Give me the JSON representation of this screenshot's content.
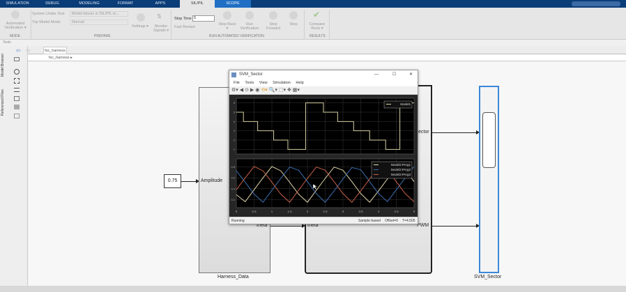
{
  "tabs": [
    "SIMULATION",
    "DEBUG",
    "MODELING",
    "FORMAT",
    "APPS",
    "SIL/PIL",
    "SCOPE"
  ],
  "ribbon": {
    "automated_verification": "Automated Verification ▾",
    "mode_group": "MODE",
    "system_under_test_label": "System Under Test",
    "system_under_test_value": "Model blocks in SIL/PIL m...",
    "top_model_mode_label": "Top Model Mode",
    "top_model_mode_value": "Normal",
    "prepare_group": "PREPARE",
    "settings": "Settings ▾",
    "monitor_signals": "Monitor Signals ▾",
    "stop_time_label": "Stop Time",
    "stop_time_value": "5",
    "fast_restart": "Fast Restart",
    "step_back": "Step Back ▾",
    "run_verification": "Run Verification",
    "step_forward": "Step Forward",
    "stop": "Stop",
    "run_group": "RUN AUTOMATED VERIFICATION",
    "compare_runs": "Compare Runs ▾",
    "results_group": "RESULTS"
  },
  "tools_label": "Tools",
  "doc_tab": "fsc_harness",
  "breadcrumb": "fsc_harness ▸",
  "side_tabs": [
    "Model Browser",
    "Referenced Files"
  ],
  "blocks": {
    "constant_value": "0.75",
    "harness_name": "Harness_Data",
    "amplitude_port": "Amplitude",
    "theta_out": "theta",
    "theta_in": "theta",
    "sector_port": "ector",
    "pwm_port": "PWM",
    "svm_name": "SVM_Sector"
  },
  "scope": {
    "title": "SVM_Sector",
    "menu": [
      "File",
      "Tools",
      "View",
      "Simulation",
      "Help"
    ],
    "status_left": "Running",
    "status_sample": "Sample based",
    "status_offset": "Offset=0",
    "status_time": "T=4.505"
  },
  "chart_data": [
    {
      "type": "line",
      "title": "",
      "series": [
        {
          "name": "Model1",
          "color": "#d8d0a0",
          "steps": [
            [
              0,
              5
            ],
            [
              0.2,
              4
            ],
            [
              0.6,
              3
            ],
            [
              1.05,
              2
            ],
            [
              1.45,
              1
            ],
            [
              1.95,
              6
            ],
            [
              2.45,
              5
            ],
            [
              2.85,
              4
            ],
            [
              3.3,
              3
            ],
            [
              3.75,
              2
            ],
            [
              4.2,
              1
            ],
            [
              4.6,
              6
            ]
          ]
        }
      ],
      "xlim": [
        0,
        5
      ],
      "ylim": [
        0.5,
        6.5
      ],
      "yticks": [
        1,
        2,
        3,
        4,
        5,
        6
      ],
      "grid": true,
      "legend": "top-right"
    },
    {
      "type": "line",
      "title": "",
      "x": [
        0,
        0.25,
        0.5,
        0.75,
        1,
        1.25,
        1.5,
        1.75,
        2,
        2.25,
        2.5,
        2.75,
        3,
        3.25,
        3.5,
        3.75,
        4,
        4.25,
        4.5,
        4.75,
        5
      ],
      "series": [
        {
          "name": "Model2:PArg1",
          "color": "#e0d4a8",
          "values": [
            0.29,
            0.16,
            0.38,
            0.6,
            0.81,
            0.73,
            0.52,
            0.3,
            0.15,
            0.37,
            0.59,
            0.8,
            0.74,
            0.53,
            0.31,
            0.15,
            0.36,
            0.58,
            0.79,
            0.75,
            0.53
          ]
        },
        {
          "name": "Model2:PArg2",
          "color": "#3d6fb0",
          "values": [
            0.73,
            0.52,
            0.3,
            0.15,
            0.37,
            0.59,
            0.8,
            0.74,
            0.53,
            0.31,
            0.15,
            0.36,
            0.58,
            0.79,
            0.75,
            0.53,
            0.31,
            0.16,
            0.38,
            0.6,
            0.81
          ]
        },
        {
          "name": "Model2:PArg3",
          "color": "#c8604a",
          "values": [
            0.38,
            0.6,
            0.81,
            0.73,
            0.52,
            0.3,
            0.15,
            0.37,
            0.59,
            0.8,
            0.74,
            0.53,
            0.31,
            0.15,
            0.36,
            0.58,
            0.79,
            0.75,
            0.53,
            0.31,
            0.16
          ]
        }
      ],
      "xlim": [
        0,
        5
      ],
      "ylim": [
        0.05,
        0.95
      ],
      "yticks": [
        0.2,
        0.4,
        0.6,
        0.8
      ],
      "xticks": [
        "0",
        "0.5",
        "1",
        "1.5",
        "2",
        "2.5",
        "3",
        "3.5",
        "4",
        "4.5",
        "5"
      ],
      "grid": true,
      "legend": "top-right"
    }
  ]
}
